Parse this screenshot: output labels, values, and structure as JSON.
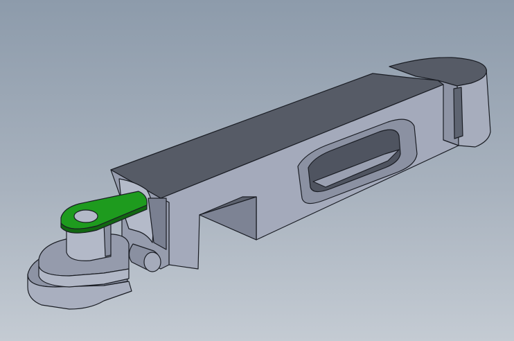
{
  "scene": {
    "view": "3d-cad-model",
    "part": "slotted-bracket-with-pivot-tab",
    "colors": {
      "background_top": "#8d9bab",
      "background_bottom": "#c4cbd3",
      "top_face": "#565b66",
      "front_face": "#8e94a5",
      "light_face": "#a7adbd",
      "side_face": "#7a8091",
      "edge": "#1a1d24",
      "selected_face": "#1e9b1e"
    },
    "selection": {
      "face": "pivot-tab-top",
      "highlight": "green"
    }
  }
}
